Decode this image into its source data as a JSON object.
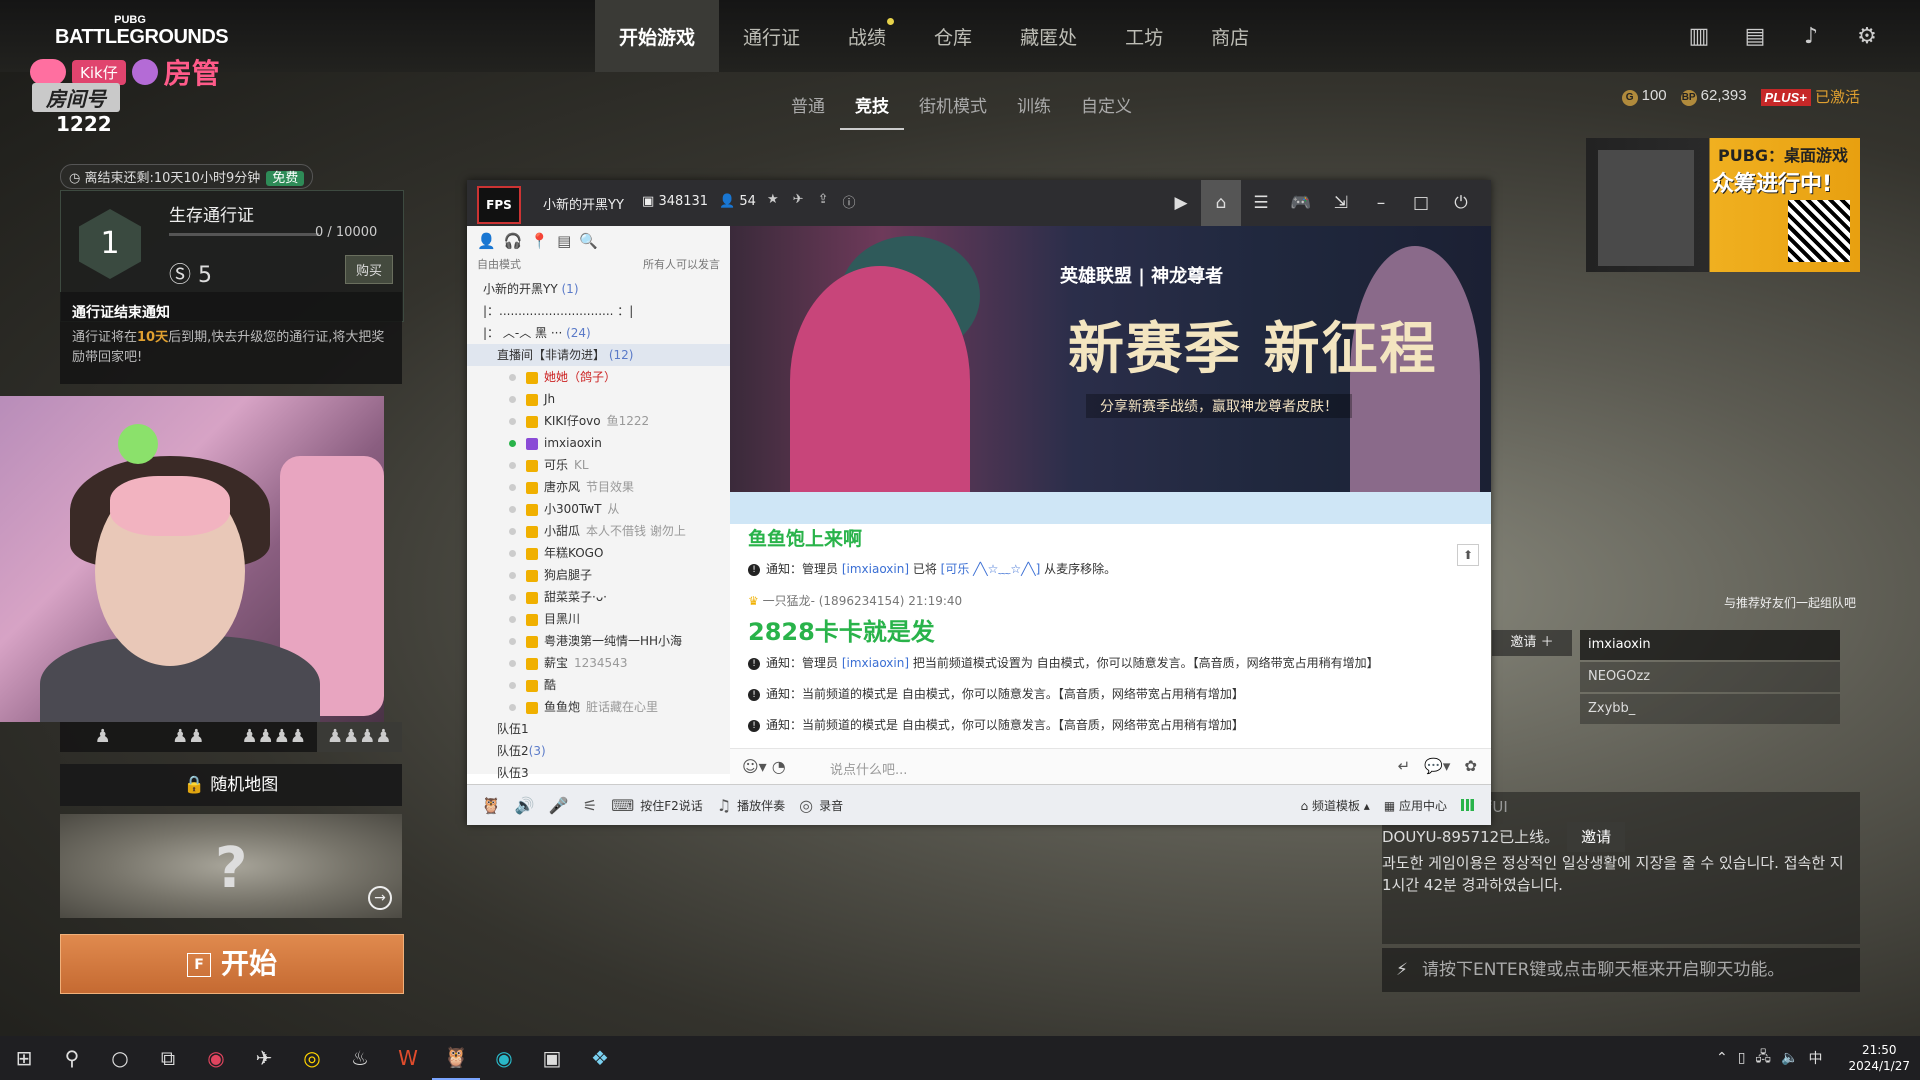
{
  "game": {
    "logo_top": "PUBG",
    "logo_main": "BATTLEGROUNDS",
    "nav": [
      {
        "label": "开始游戏",
        "active": true
      },
      {
        "label": "通行证"
      },
      {
        "label": "战绩"
      },
      {
        "label": "仓库"
      },
      {
        "label": "藏匿处"
      },
      {
        "label": "工坊"
      },
      {
        "label": "商店"
      }
    ],
    "subnav": [
      {
        "label": "普通"
      },
      {
        "label": "竞技",
        "active": true
      },
      {
        "label": "街机模式"
      },
      {
        "label": "训练"
      },
      {
        "label": "自定义"
      }
    ],
    "top_icons": [
      "shop-icon",
      "mission-icon",
      "bell-icon",
      "gear-icon"
    ],
    "currency": {
      "g_value": "100",
      "bp_value": "62,393",
      "plus_label": "PLUS+",
      "activated": "已激活"
    }
  },
  "overlay": {
    "kik": "Kik仔",
    "admin": "房管",
    "room_label": "房间号",
    "room_number": "1222"
  },
  "pass": {
    "timer": "离结束还剩:10天10小时9分钟",
    "free": "免费",
    "level": "1",
    "title": "生存通行证",
    "progress": "0 / 10000",
    "progress_fraction": 0,
    "sp": "5",
    "buy": "购买",
    "notice_title": "通行证结束通知",
    "notice_body_pre": "通行证将在",
    "notice_days": "10天",
    "notice_body_post": "后到期,快去升级您的通行证,将大把奖励带回家吧!"
  },
  "squad": {
    "options": [
      "1",
      "2",
      "3",
      "4"
    ]
  },
  "map": {
    "random_label": "随机地图",
    "start_key": "F",
    "start_label": "开始"
  },
  "yy": {
    "logo": "FPS",
    "channel_name": "小新的开黑YY",
    "channel_id": "348131",
    "online": "54",
    "mode": "自由模式",
    "mode_right": "所有人可以发言",
    "tree": [
      {
        "level": 0,
        "text": "小新的开黑YY",
        "count": "(1)"
      },
      {
        "level": 0,
        "text": "|：.............................. ：|"
      },
      {
        "level": 0,
        "text": "|：       ︿-︿       黑       ···",
        "count": "(24)"
      },
      {
        "level": 0,
        "text": "直播间【非请勿进】",
        "count": "(12)",
        "selected": true
      },
      {
        "level": 2,
        "text": "她她（鸽子）",
        "red": true
      },
      {
        "level": 2,
        "text": "Jh"
      },
      {
        "level": 2,
        "text": "KIKI仔ovo",
        "tag": "鱼1222"
      },
      {
        "level": 2,
        "text": "imxiaoxin",
        "online": true
      },
      {
        "level": 2,
        "text": "可乐",
        "tag": "KL"
      },
      {
        "level": 2,
        "text": "唐亦风",
        "tag": "节目效果"
      },
      {
        "level": 2,
        "text": "小300TwT",
        "tag": "从"
      },
      {
        "level": 2,
        "text": "小甜瓜",
        "tag": "本人不借钱 谢勿上"
      },
      {
        "level": 2,
        "text": "年糕KOGO"
      },
      {
        "level": 2,
        "text": "狗启腿子"
      },
      {
        "level": 2,
        "text": "甜菜菜子·ᴗ·"
      },
      {
        "level": 2,
        "text": "目黑川"
      },
      {
        "level": 2,
        "text": "粤港澳第一纯情一HH小海"
      },
      {
        "level": 2,
        "text": "薪宝",
        "tag": "1234543"
      },
      {
        "level": 2,
        "text": "酷"
      },
      {
        "level": 2,
        "text": "鱼鱼炮",
        "tag": "脏话藏在心里"
      },
      {
        "level": 1,
        "text": "队伍1"
      },
      {
        "level": 1,
        "text": "队伍2",
        "count": "(3)"
      },
      {
        "level": 1,
        "text": "队伍3"
      }
    ],
    "banner": {
      "brand": "英雄联盟 | 神龙尊者",
      "headline": "新赛季 新征程",
      "sub": "分享新赛季战绩，赢取神龙尊者皮肤！"
    },
    "chat": {
      "msg_big1": "鱼鱼饱上来啊",
      "notice1_pre": "通知：管理员 ",
      "notice1_admin": "[imxiaoxin]",
      "notice1_mid": " 已将 ",
      "notice1_user": "[可乐 ╱╲☆﹏☆╱╲]",
      "notice1_post": " 从麦序移除。",
      "meta2": "一只猛龙- (1896234154) 21:19:40",
      "msg_big2": "2828卡卡就是发",
      "notice2_pre": "通知：管理员 ",
      "notice2_admin": "[imxiaoxin]",
      "notice2_post": " 把当前频道模式设置为 自由模式，你可以随意发言。【高音质，网络带宽占用稍有增加】",
      "notice3": "通知：当前频道的模式是 自由模式，你可以随意发言。【高音质，网络带宽占用稍有增加】",
      "notice4": "通知：当前频道的模式是 自由模式，你可以随意发言。【高音质，网络带宽占用稍有增加】"
    },
    "input_placeholder": "说点什么吧...",
    "bottom": {
      "f2": "按住F2说话",
      "music": "播放伴奏",
      "record": "录音",
      "template": "频道模板",
      "apps": "应用中心"
    }
  },
  "ad": {
    "t1": "PUBG：桌面游戏",
    "t2": "众筹进行中!"
  },
  "party": {
    "hint": "与推荐好友们一起组队吧",
    "invite": "邀请",
    "friends": [
      "imxiaoxin",
      "NEOGOzz",
      "Zxybb_"
    ]
  },
  "gchat": {
    "l1": "空格键-隐藏大厅UI",
    "l2": "DOUYU-895712已上线。",
    "l2_btn": "邀请",
    "l3": "과도한 게임이용은 정상적인 일상생활에 지장을 줄 수 있습니다. 접속한 지 1시간 42분 경과하였습니다.",
    "input": "请按下ENTER键或点击聊天框来开启聊天功能。"
  },
  "taskbar": {
    "apps": [
      "windows-icon",
      "search-icon",
      "cortana-icon",
      "taskview-icon",
      "netease-icon",
      "feishu-icon",
      "obs-icon",
      "steam-icon",
      "wps-icon",
      "yy-icon",
      "edge-icon",
      "pubg-icon",
      "app-icon"
    ],
    "ime": "中",
    "time": "21:50",
    "date": "2024/1/27"
  }
}
